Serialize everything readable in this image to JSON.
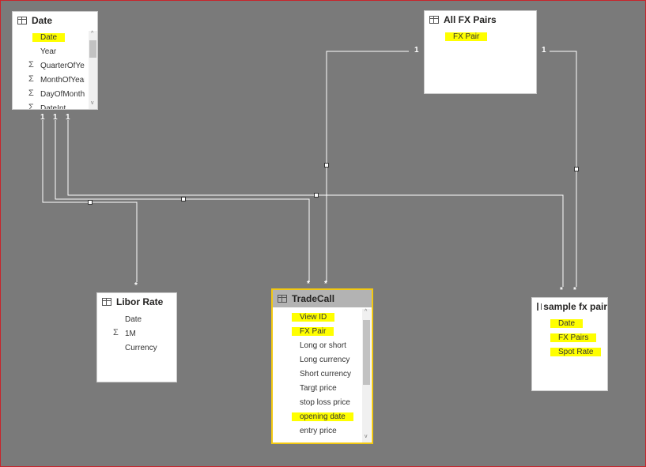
{
  "tables": {
    "date": {
      "title": "Date",
      "fields": [
        "Date",
        "Year",
        "QuarterOfYear",
        "MonthOfYear",
        "DayOfMonth",
        "DateInt"
      ]
    },
    "all_fx_pairs": {
      "title": "All FX Pairs",
      "fields": [
        "FX Pair"
      ]
    },
    "libor_rate": {
      "title": "Libor Rate",
      "fields": [
        "Date",
        "1M",
        "Currency"
      ]
    },
    "tradecall": {
      "title": "TradeCall",
      "fields": [
        "View ID",
        "FX Pair",
        "Long or short",
        "Long currency",
        "Short currency",
        "Targt price",
        "stop loss price",
        "opening date",
        "entry price"
      ]
    },
    "sample_fx": {
      "title": "sample fx pair",
      "fields": [
        "Date",
        "FX Pairs",
        "Spot Rate"
      ]
    }
  },
  "cardinality": {
    "one": "1",
    "many": "*"
  },
  "icons": {
    "table": "table-icon",
    "sigma": "sigma-icon",
    "scroll_up": "chevron-up-icon",
    "scroll_down": "chevron-down-icon"
  },
  "glyphs": {
    "sigma": "Σ",
    "up": "^",
    "down": "v"
  },
  "colors": {
    "canvas": "#7a7a7a",
    "highlight": "#ffff00",
    "selected_border": "#f2c811",
    "frame": "#c8232b"
  }
}
